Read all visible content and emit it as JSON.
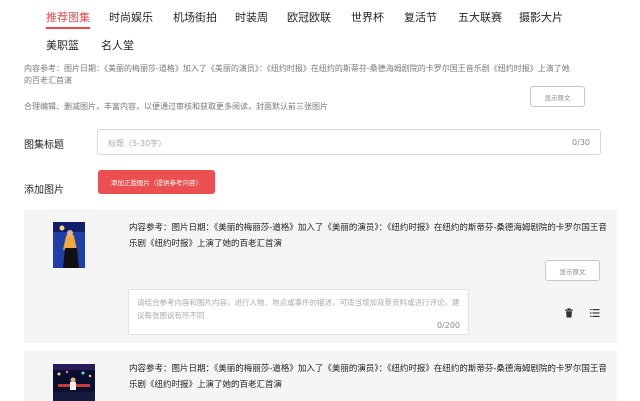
{
  "nav": {
    "tabs": [
      {
        "label": "推荐图集",
        "active": true
      },
      {
        "label": "时尚娱乐",
        "active": false
      },
      {
        "label": "机场街拍",
        "active": false
      },
      {
        "label": "时装周",
        "active": false
      },
      {
        "label": "欧冠欧联",
        "active": false
      },
      {
        "label": "世界杯",
        "active": false
      },
      {
        "label": "复活节",
        "active": false
      },
      {
        "label": "五大联赛",
        "active": false
      },
      {
        "label": "摄影大片",
        "active": false
      },
      {
        "label": "美职篮",
        "active": false
      },
      {
        "label": "名人堂",
        "active": false
      }
    ],
    "active_color": "#e8474b"
  },
  "intro": {
    "reference_line1": "内容参考：图片日期：《美丽的梅丽莎-道格》加入了《美丽的演员》：《纽约时报》在纽约的斯蒂芬-桑德海姆剧院的卡罗尔国王音乐剧《纽约时报》上演了她",
    "reference_line2": "的百老汇首演",
    "tip": "合理编辑、删减图片，丰富内容，以便通过审核和获取更多阅读，封面默认前三张图片",
    "show_original_label": "显示原文"
  },
  "form": {
    "title_label": "图集标题",
    "title_placeholder": "标题（5-30字）",
    "title_counter": "0/30",
    "add_images_label": "添加图片",
    "add_button_label": "添加正版图片（提供参考内容）",
    "accent_color": "#ec4f4f"
  },
  "cards": [
    {
      "text_line1": "内容参考：图片日期：《美丽的梅丽莎-道格》加入了《美丽的演员》：《纽约时报》在纽约的斯蒂芬-桑德海姆剧院的卡罗尔国王音",
      "text_line2": "乐剧《纽约时报》上演了她的百老汇首演",
      "show_original_label": "显示原文",
      "description_placeholder": "请结合参考内容和图片内容，进行人物、地点或事件的描述，可适当增加背景资料或进行评论，建议每张图说有所不同",
      "description_counter": "0/200",
      "delete_icon": "trash-icon",
      "sort_icon": "list-icon"
    },
    {
      "text_line1": "内容参考：图片日期：《美丽的梅丽莎-道格》加入了《美丽的演员》：《纽约时报》在纽约的斯蒂芬-桑德海姆剧院的卡罗尔国王音",
      "text_line2": "乐剧《纽约时报》上演了她的百老汇首演"
    }
  ]
}
